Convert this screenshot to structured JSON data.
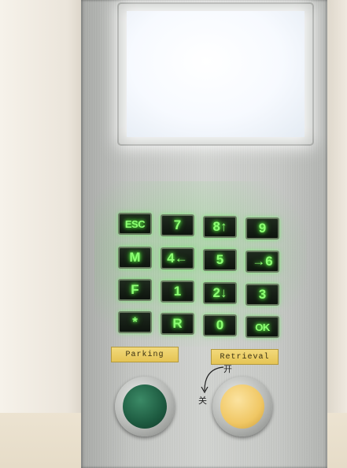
{
  "keypad": {
    "rows": [
      [
        "ESC",
        "7",
        "8↑",
        "9"
      ],
      [
        "M",
        "4←",
        "5",
        "→6"
      ],
      [
        "F",
        "1",
        "2↓",
        "3"
      ],
      [
        "*",
        "R",
        "0",
        "OK"
      ]
    ]
  },
  "buttons": {
    "parking_label": "Parking",
    "retrieval_label": "Retrieval",
    "dial_open": "开",
    "dial_close": "关"
  },
  "colors": {
    "key_glow": "#6dff4f",
    "label_plate": "#e5c455",
    "parking_cap": "#1d5a40",
    "retrieval_cap": "#f0c764"
  }
}
